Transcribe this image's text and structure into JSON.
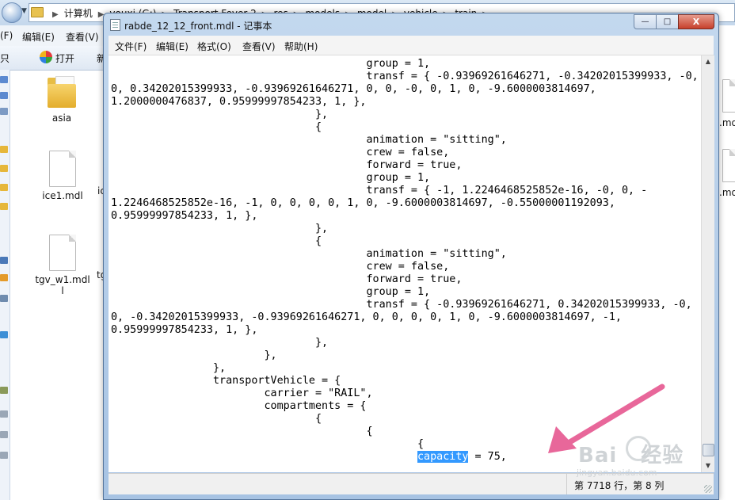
{
  "explorer": {
    "breadcrumb": [
      "计算机",
      "youxi (G:)",
      "Transport Fever 2",
      "res",
      "models",
      "model",
      "vehicle",
      "train"
    ],
    "menu": [
      "(F)",
      "编辑(E)",
      "查看(V)"
    ],
    "toolbar": {
      "left_label": "只",
      "open_label": "打开",
      "next_label": "新"
    },
    "files": [
      {
        "name": "asia",
        "type": "folder"
      },
      {
        "name": "ice1.mdl",
        "type": "file"
      },
      {
        "name": "tgv_w1.mdl",
        "type": "file"
      }
    ],
    "partial_labels": [
      "ic",
      "tg",
      "l",
      ".md",
      ".md"
    ]
  },
  "notepad": {
    "title": "rabde_12_12_front.mdl - 记事本",
    "menu": [
      "文件(F)",
      "编辑(E)",
      "格式(O)",
      "查看(V)",
      "帮助(H)"
    ],
    "caption": {
      "minimize": "—",
      "maximize": "□",
      "close": "X"
    },
    "lines": [
      "                                        group = 1,",
      "                                        transf = { -0.93969261646271, -0.34202015399933, -0,",
      "0, 0.34202015399933, -0.93969261646271, 0, 0, -0, 0, 1, 0, -9.6000003814697,",
      "1.2000000476837, 0.95999997854233, 1, },",
      "                                },",
      "                                {",
      "                                        animation = \"sitting\",",
      "                                        crew = false,",
      "                                        forward = true,",
      "                                        group = 1,",
      "                                        transf = { -1, 1.2246468525852e-16, -0, 0, -",
      "1.2246468525852e-16, -1, 0, 0, 0, 0, 1, 0, -9.6000003814697, -0.55000001192093,",
      "0.95999997854233, 1, },",
      "                                },",
      "                                {",
      "                                        animation = \"sitting\",",
      "                                        crew = false,",
      "                                        forward = true,",
      "                                        group = 1,",
      "                                        transf = { -0.93969261646271, 0.34202015399933, -0,",
      "0, -0.34202015399933, -0.93969261646271, 0, 0, 0, 0, 1, 0, -9.6000003814697, -1,",
      "0.95999997854233, 1, },",
      "                                },",
      "                        },",
      "                },",
      "                transportVehicle = {",
      "                        carrier = \"RAIL\",",
      "                        compartments = {",
      "                                {",
      "                                        {",
      "                                                {"
    ],
    "last_line": {
      "indent": "                                                ",
      "selected": "capacity",
      "rest": " = 75,"
    },
    "status": "第 7718 行，第 8 列"
  },
  "watermark": {
    "brand": "Bai",
    "brand2": "经验",
    "url": "jingyan.baidu.com"
  },
  "colors": {
    "selection": "#3399ff",
    "arrow": "#e8679a"
  }
}
